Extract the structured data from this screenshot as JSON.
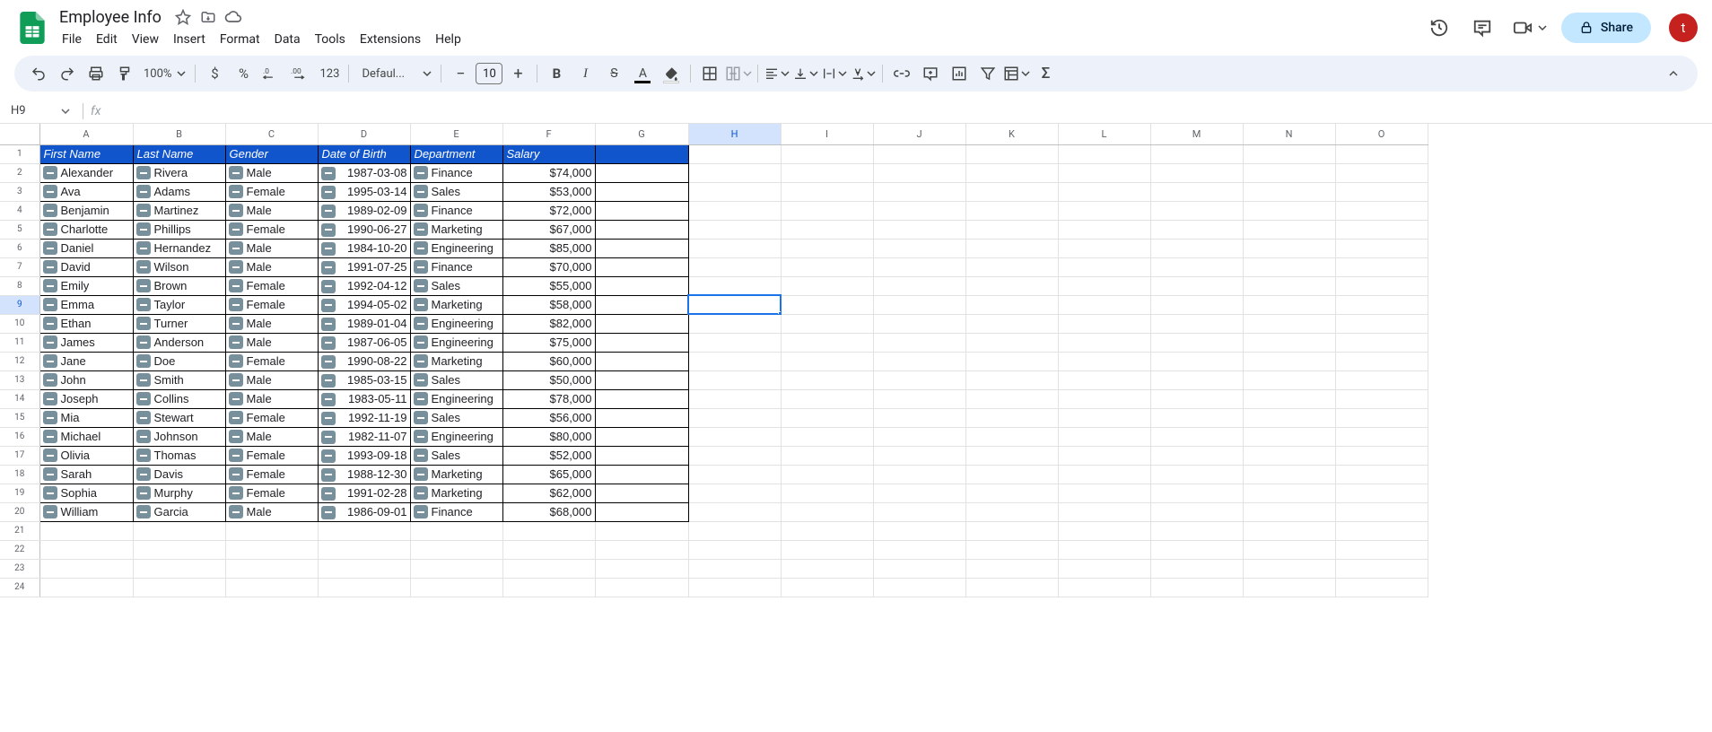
{
  "doc": {
    "title": "Employee Info"
  },
  "menus": [
    "File",
    "Edit",
    "View",
    "Insert",
    "Format",
    "Data",
    "Tools",
    "Extensions",
    "Help"
  ],
  "share_label": "Share",
  "avatar_letter": "t",
  "toolbar": {
    "zoom": "100%",
    "font": "Defaul...",
    "font_size": "10"
  },
  "name_box": "H9",
  "columns": [
    "A",
    "B",
    "C",
    "D",
    "E",
    "F",
    "G",
    "H",
    "I",
    "J",
    "K",
    "L",
    "M",
    "N",
    "O"
  ],
  "active_col": "H",
  "active_row": 9,
  "chart_data": {
    "type": "table",
    "headers": [
      "First Name",
      "Last Name",
      "Gender",
      "Date of Birth",
      "Department",
      "Salary"
    ],
    "rows": [
      [
        "Alexander",
        "Rivera",
        "Male",
        "1987-03-08",
        "Finance",
        "$74,000"
      ],
      [
        "Ava",
        "Adams",
        "Female",
        "1995-03-14",
        "Sales",
        "$53,000"
      ],
      [
        "Benjamin",
        "Martinez",
        "Male",
        "1989-02-09",
        "Finance",
        "$72,000"
      ],
      [
        "Charlotte",
        "Phillips",
        "Female",
        "1990-06-27",
        "Marketing",
        "$67,000"
      ],
      [
        "Daniel",
        "Hernandez",
        "Male",
        "1984-10-20",
        "Engineering",
        "$85,000"
      ],
      [
        "David",
        "Wilson",
        "Male",
        "1991-07-25",
        "Finance",
        "$70,000"
      ],
      [
        "Emily",
        "Brown",
        "Female",
        "1992-04-12",
        "Sales",
        "$55,000"
      ],
      [
        "Emma",
        "Taylor",
        "Female",
        "1994-05-02",
        "Marketing",
        "$58,000"
      ],
      [
        "Ethan",
        "Turner",
        "Male",
        "1989-01-04",
        "Engineering",
        "$82,000"
      ],
      [
        "James",
        "Anderson",
        "Male",
        "1987-06-05",
        "Engineering",
        "$75,000"
      ],
      [
        "Jane",
        "Doe",
        "Female",
        "1990-08-22",
        "Marketing",
        "$60,000"
      ],
      [
        "John",
        "Smith",
        "Male",
        "1985-03-15",
        "Sales",
        "$50,000"
      ],
      [
        "Joseph",
        "Collins",
        "Male",
        "1983-05-11",
        "Engineering",
        "$78,000"
      ],
      [
        "Mia",
        "Stewart",
        "Female",
        "1992-11-19",
        "Sales",
        "$56,000"
      ],
      [
        "Michael",
        "Johnson",
        "Male",
        "1982-11-07",
        "Engineering",
        "$80,000"
      ],
      [
        "Olivia",
        "Thomas",
        "Female",
        "1993-09-18",
        "Sales",
        "$52,000"
      ],
      [
        "Sarah",
        "Davis",
        "Female",
        "1988-12-30",
        "Marketing",
        "$65,000"
      ],
      [
        "Sophia",
        "Murphy",
        "Female",
        "1991-02-28",
        "Marketing",
        "$62,000"
      ],
      [
        "William",
        "Garcia",
        "Male",
        "1986-09-01",
        "Finance",
        "$68,000"
      ]
    ]
  },
  "empty_rows": [
    21,
    22,
    23,
    24
  ],
  "col_widths": {
    "rowhdr": 44,
    "A": 104,
    "B": 103,
    "C": 103,
    "D": 103,
    "E": 103,
    "F": 103,
    "G": 104,
    "H": 103,
    "I": 103,
    "J": 103,
    "K": 103,
    "L": 103,
    "M": 103,
    "N": 103,
    "O": 103
  }
}
